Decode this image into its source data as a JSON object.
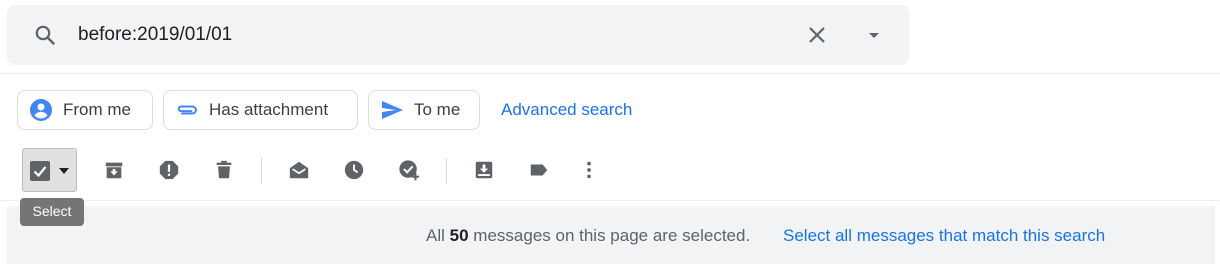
{
  "search": {
    "query": "before:2019/01/01"
  },
  "chips": [
    {
      "label": "From me"
    },
    {
      "label": "Has attachment"
    },
    {
      "label": "To me"
    }
  ],
  "advanced_search_label": "Advanced search",
  "toolbar": {
    "tooltip": "Select"
  },
  "banner": {
    "prefix": "All",
    "count": "50",
    "suffix": "messages on this page are selected.",
    "select_all_label": "Select all messages that match this search"
  },
  "colors": {
    "accent": "#1a73e8",
    "chip_icon": "#4285f4",
    "icon_gray": "#5f6368",
    "surface": "#f1f3f4"
  },
  "icons": {
    "search": "search-icon",
    "clear": "close-icon",
    "dropdown": "caret-down-icon",
    "from_me": "account-circle-icon",
    "attachment": "paperclip-icon",
    "to_me": "send-icon",
    "archive": "archive-icon",
    "spam": "report-spam-icon",
    "delete": "trash-icon",
    "mark_read": "open-envelope-icon",
    "snooze": "clock-icon",
    "add_task": "add-task-icon",
    "move_to": "move-to-inbox-icon",
    "label": "label-icon",
    "more": "more-vert-icon"
  }
}
